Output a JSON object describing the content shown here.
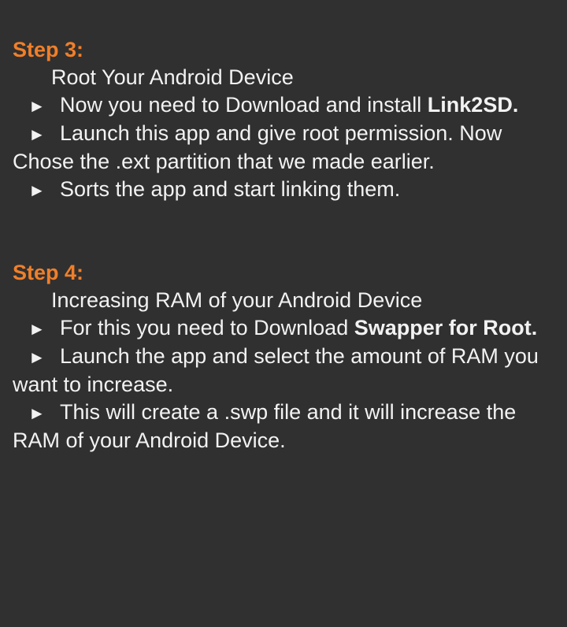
{
  "bullet_symbol": "►",
  "steps": [
    {
      "heading": "Step 3:",
      "subtitle": "Root Your Android Device",
      "items": [
        {
          "text": "Now you need to Download and install ",
          "bold": "Link2SD.",
          "tail": ""
        },
        {
          "text": "Launch this app and give root permission. Now Chose the .ext partition that we made earlier.",
          "bold": "",
          "tail": ""
        },
        {
          "text": "Sorts the app and start linking them.",
          "bold": "",
          "tail": ""
        }
      ]
    },
    {
      "heading": "Step 4:",
      "subtitle": "Increasing RAM of your Android Device",
      "items": [
        {
          "text": "For this you need to Download ",
          "bold": "Swapper for Root.",
          "tail": ""
        },
        {
          "text": "Launch the app and select the amount of RAM you want to increase.",
          "bold": "",
          "tail": ""
        },
        {
          "text": "This will create a .swp file and it will increase the RAM of your Android Device.",
          "bold": "",
          "tail": ""
        }
      ]
    }
  ]
}
